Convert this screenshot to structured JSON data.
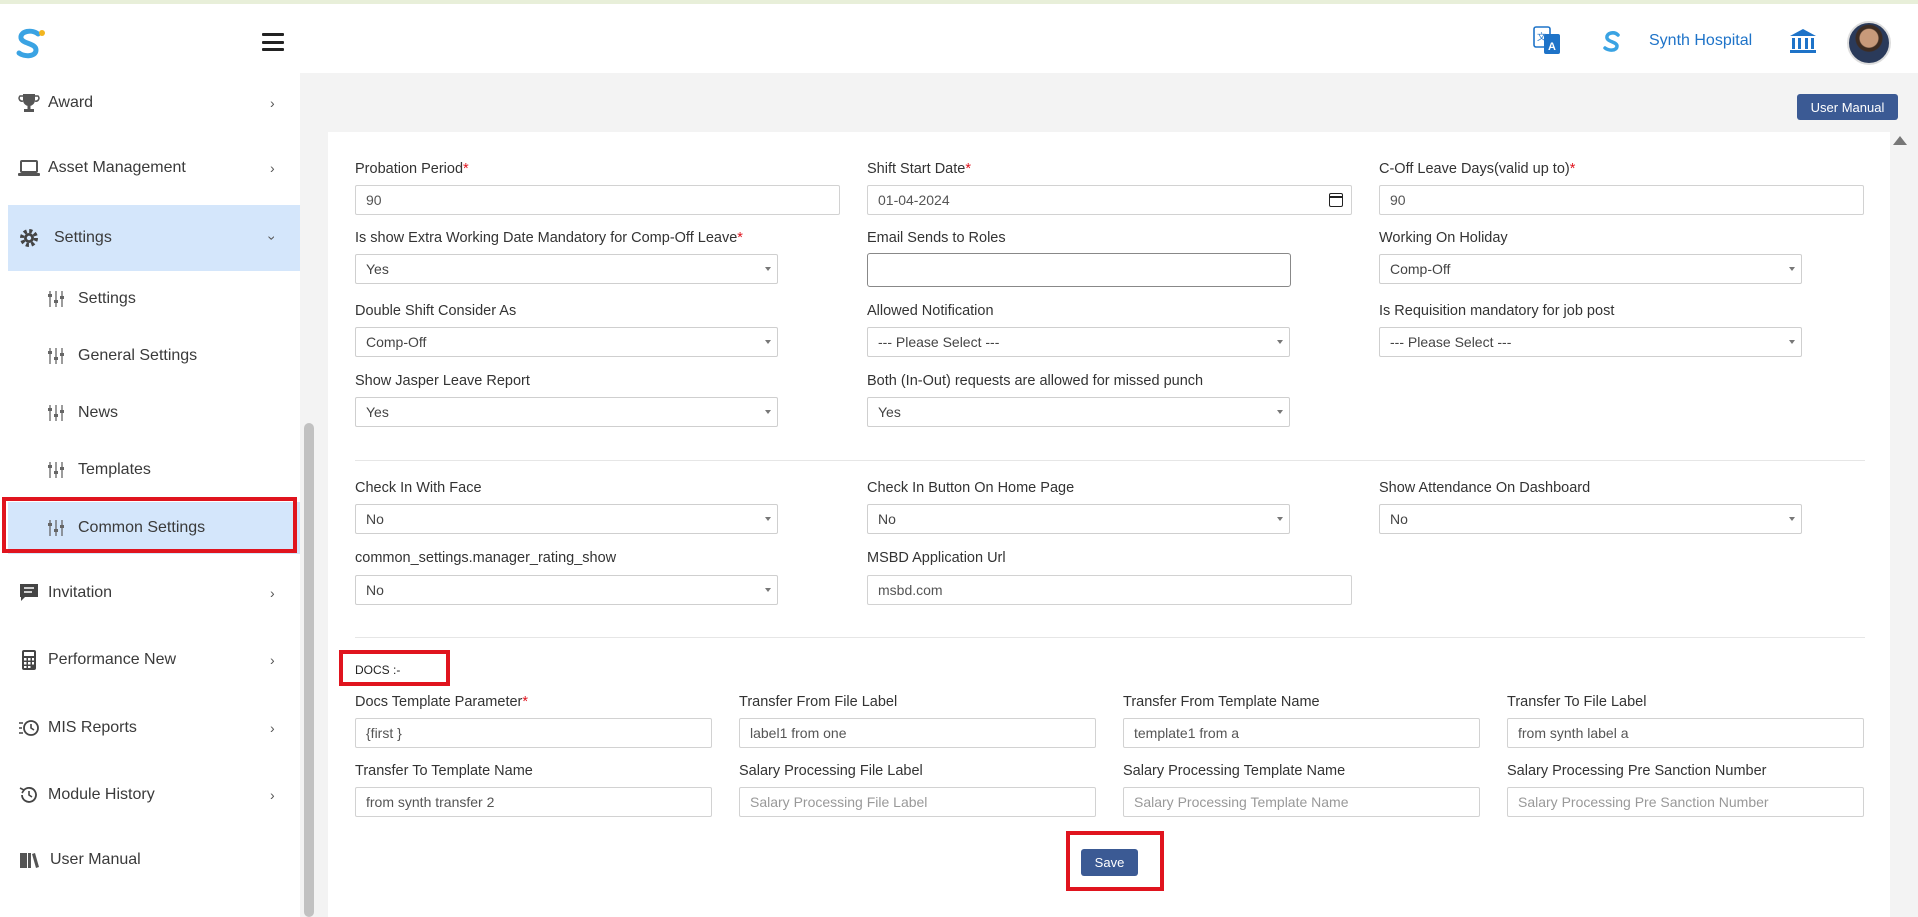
{
  "header": {
    "hospital_name": "Synth Hospital",
    "icons": [
      "app-logo-icon",
      "hamburger-icon",
      "translate-icon",
      "hospital-logo-icon",
      "bank-icon",
      "user-avatar"
    ]
  },
  "sidebar": {
    "items": [
      {
        "label": "Award",
        "icon": "trophy-icon"
      },
      {
        "label": "Asset Management",
        "icon": "laptop-icon"
      },
      {
        "label": "Settings",
        "icon": "gear-icon"
      },
      {
        "label": "Invitation",
        "icon": "message-icon"
      },
      {
        "label": "Performance New",
        "icon": "calculator-icon"
      },
      {
        "label": "MIS Reports",
        "icon": "clock-list-icon"
      },
      {
        "label": "Module History",
        "icon": "history-icon"
      },
      {
        "label": "User Manual",
        "icon": "book-icon"
      }
    ],
    "sub_items": [
      {
        "label": "Settings"
      },
      {
        "label": "General Settings"
      },
      {
        "label": "News"
      },
      {
        "label": "Templates"
      },
      {
        "label": "Common Settings"
      }
    ],
    "active_color": "#d4e6fb"
  },
  "toolbar": {
    "user_manual_label": "User Manual"
  },
  "form": {
    "probation_period": {
      "label": "Probation Period",
      "value": "90"
    },
    "shift_start_date": {
      "label": "Shift Start Date",
      "value": "01-04-2024"
    },
    "coff_leave_days": {
      "label": "C-Off Leave Days(valid up to)",
      "value": "90"
    },
    "extra_working_date": {
      "label": "Is show Extra Working Date Mandatory for Comp-Off Leave",
      "value": "Yes"
    },
    "email_sends_to_roles": {
      "label": "Email Sends to Roles",
      "value": ""
    },
    "working_on_holiday": {
      "label": "Working On Holiday",
      "value": "Comp-Off"
    },
    "double_shift": {
      "label": "Double Shift Consider As",
      "value": "Comp-Off"
    },
    "allowed_notification": {
      "label": "Allowed Notification",
      "value": "--- Please Select ---"
    },
    "requisition_mandatory": {
      "label": "Is Requisition mandatory for job post",
      "value": "--- Please Select ---"
    },
    "jasper_leave_report": {
      "label": "Show Jasper Leave Report",
      "value": "Yes"
    },
    "missed_punch": {
      "label": "Both (In-Out) requests are allowed for missed punch",
      "value": "Yes"
    },
    "check_in_face": {
      "label": "Check In With Face",
      "value": "No"
    },
    "check_in_home": {
      "label": "Check In Button On Home Page",
      "value": "No"
    },
    "attendance_dashboard": {
      "label": "Show Attendance On Dashboard",
      "value": "No"
    },
    "manager_rating_show": {
      "label": "common_settings.manager_rating_show",
      "value": "No"
    },
    "msbd_url": {
      "label": "MSBD Application Url",
      "value": "msbd.com"
    },
    "required_mark": "*"
  },
  "docs": {
    "title": "DOCS :-",
    "template_parameter": {
      "label": "Docs Template Parameter",
      "value": "{first }"
    },
    "transfer_from_file_label": {
      "label": "Transfer From File Label",
      "value": "label1 from one"
    },
    "transfer_from_template_name": {
      "label": "Transfer From Template Name",
      "value": "template1 from a"
    },
    "transfer_to_file_label": {
      "label": "Transfer To File Label",
      "value": "from synth label a"
    },
    "transfer_to_template_name": {
      "label": "Transfer To Template Name",
      "value": "from synth transfer 2"
    },
    "salary_file_label": {
      "label": "Salary Processing File Label",
      "placeholder": "Salary Processing File Label"
    },
    "salary_template_name": {
      "label": "Salary Processing Template Name",
      "placeholder": "Salary Processing Template Name"
    },
    "salary_pre_sanction": {
      "label": "Salary Processing Pre Sanction Number",
      "placeholder": "Salary Processing Pre Sanction Number"
    }
  },
  "actions": {
    "save_label": "Save"
  },
  "colors": {
    "primary_button": "#3b5a94",
    "highlight": "#e0141e",
    "brand": "#1e73c8"
  }
}
